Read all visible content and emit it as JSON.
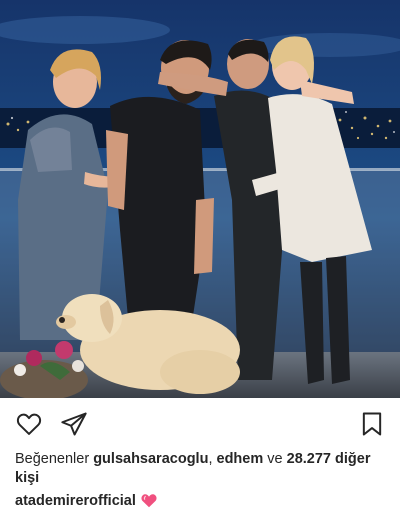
{
  "post": {
    "photo_alt": "group photo",
    "actions": {
      "like_icon": "heart-outline-icon",
      "share_icon": "send-icon",
      "save_icon": "bookmark-icon"
    },
    "likes": {
      "prefix": "Beğenenler",
      "user1": "gulsahsaracoglu",
      "sep1": ",",
      "user2": "edhem",
      "and": "ve",
      "others_count": "28.277",
      "others_word": "diğer",
      "others_suffix": "kişi"
    },
    "caption": {
      "username": "atademirerofficial",
      "emoji": "pink-heart-emoji"
    },
    "colors": {
      "text": "#262626",
      "emoji_heart": "#f0507f"
    }
  }
}
